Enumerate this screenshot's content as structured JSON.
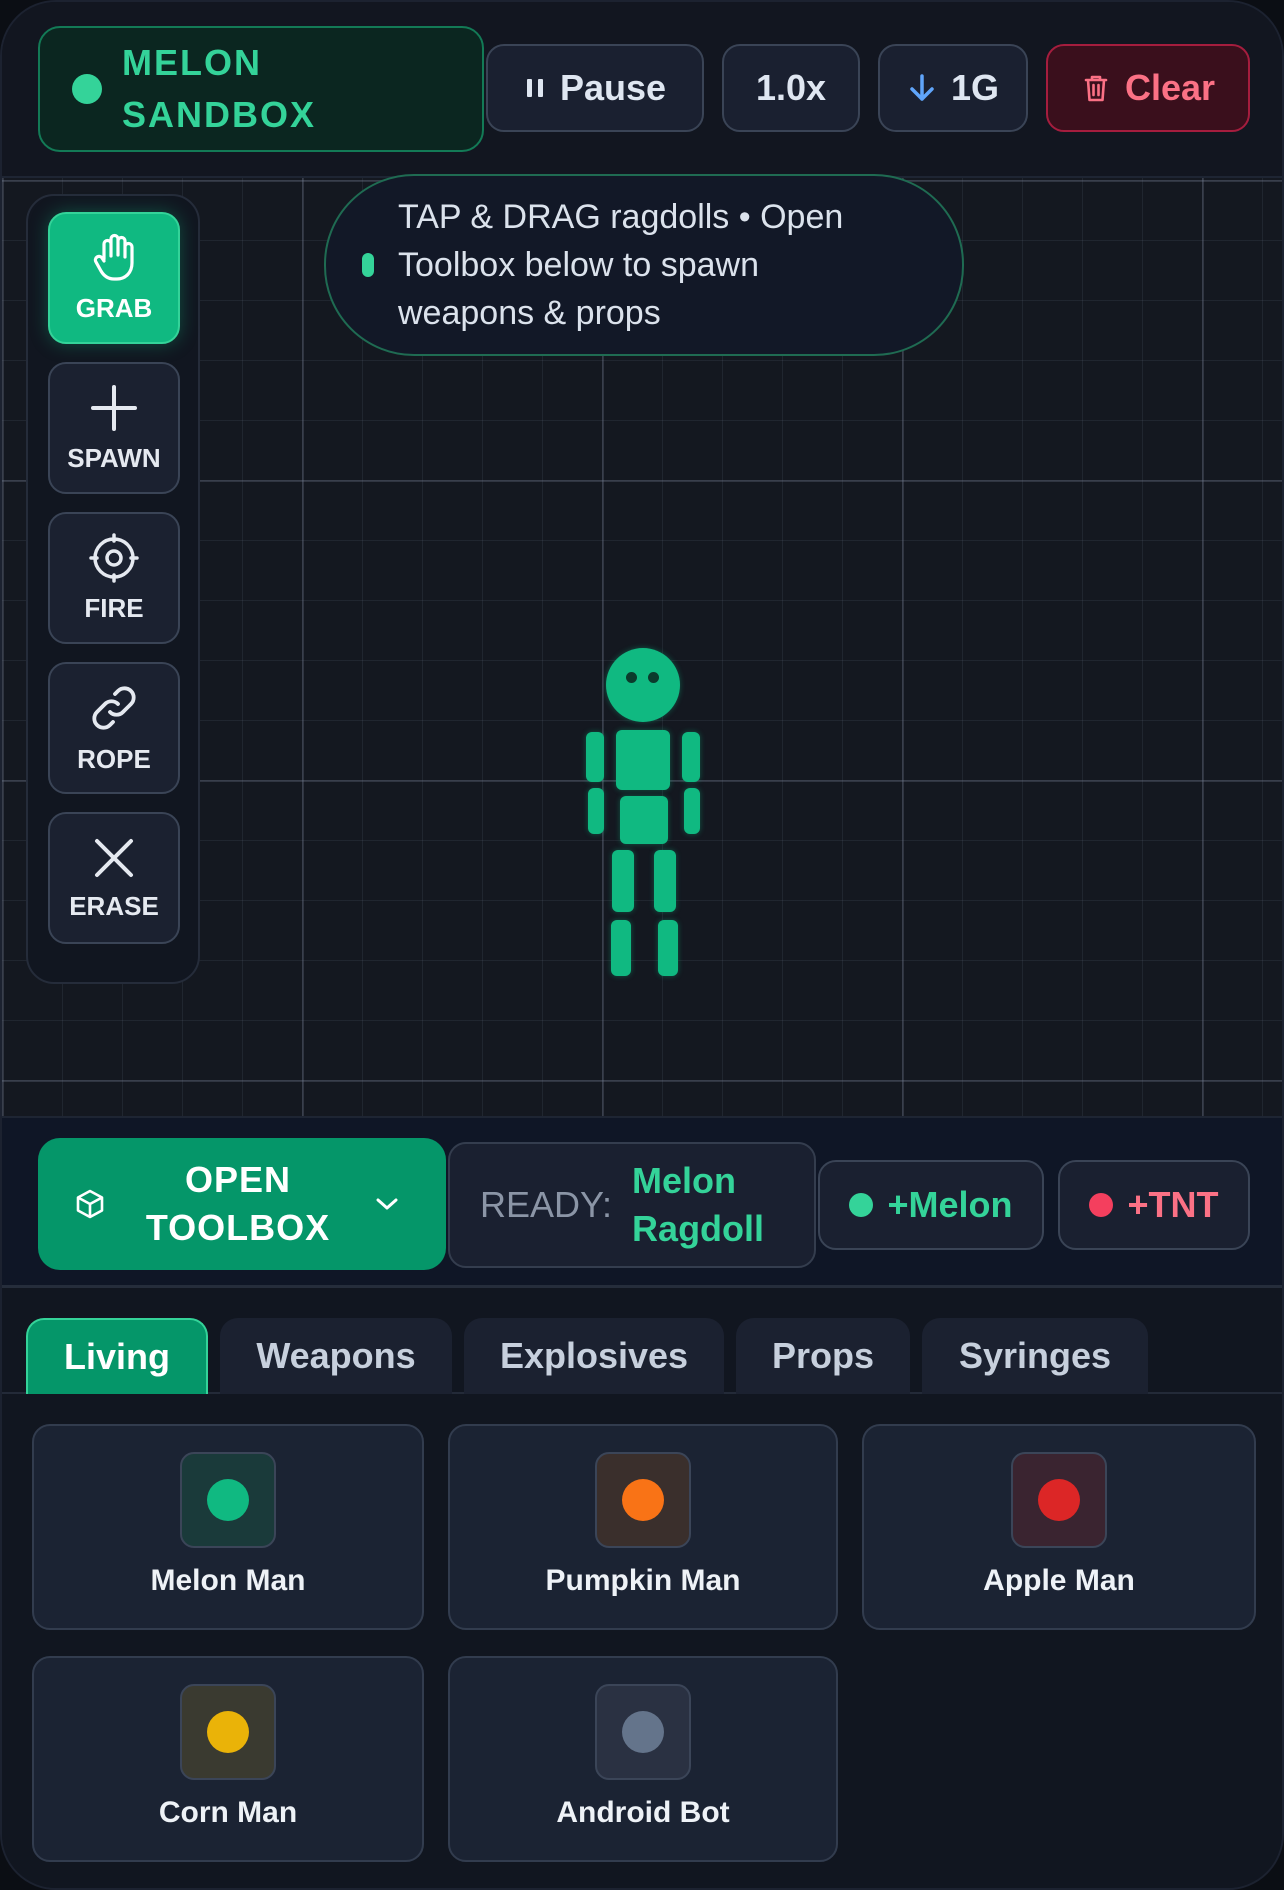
{
  "header": {
    "brand": "MELON SANDBOX",
    "brand_color": "#34d399",
    "pause_label": "Pause",
    "pause_icon": "pause-icon",
    "speed_label": "1.0x",
    "gravity_label": "1G",
    "gravity_icon": "arrow-down-icon",
    "clear_label": "Clear",
    "clear_icon": "trash-icon"
  },
  "tools": [
    {
      "label": "GRAB",
      "icon": "hand-icon",
      "active": true
    },
    {
      "label": "SPAWN",
      "icon": "plus-icon",
      "active": false
    },
    {
      "label": "FIRE",
      "icon": "crosshair-icon",
      "active": false
    },
    {
      "label": "ROPE",
      "icon": "link-icon",
      "active": false
    },
    {
      "label": "ERASE",
      "icon": "x-icon",
      "active": false
    }
  ],
  "hint": {
    "text": "TAP & DRAG ragdolls • Open Toolbox below to spawn weapons & props"
  },
  "actionbar": {
    "open_toolbox_label": "OPEN TOOLBOX",
    "ready_label": "READY:",
    "ready_value": "Melon Ragdoll",
    "quick_melon": "+Melon",
    "quick_tnt": "+TNT"
  },
  "tabs": [
    {
      "label": "Living",
      "active": true
    },
    {
      "label": "Weapons",
      "active": false
    },
    {
      "label": "Explosives",
      "active": false
    },
    {
      "label": "Props",
      "active": false
    },
    {
      "label": "Syringes",
      "active": false
    }
  ],
  "items": [
    {
      "name": "Melon Man",
      "color": "#10b981",
      "bg": "#1a3a3a"
    },
    {
      "name": "Pumpkin Man",
      "color": "#f97316",
      "bg": "#3a2f2c"
    },
    {
      "name": "Apple Man",
      "color": "#dc2626",
      "bg": "#3a2430"
    },
    {
      "name": "Corn Man",
      "color": "#eab308",
      "bg": "#3a3a30"
    },
    {
      "name": "Android Bot",
      "color": "#64748b",
      "bg": "#2a3142"
    }
  ],
  "colors": {
    "accent": "#10b981",
    "danger": "#f43f5e",
    "canvas_bg": "#141820"
  }
}
